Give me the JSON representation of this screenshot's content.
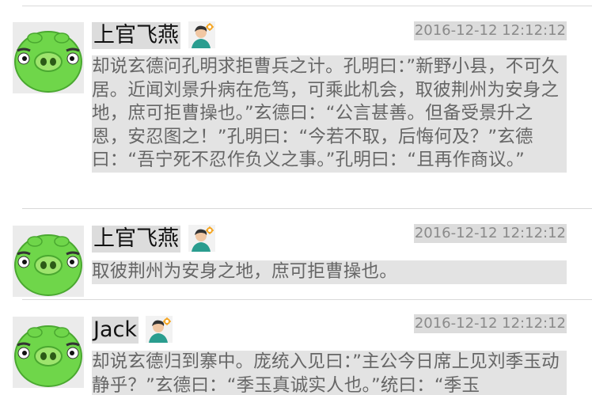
{
  "posts": [
    {
      "username": "上官飞燕",
      "timestamp": "2016-12-12 12:12:12",
      "content": "却说玄德问孔明求拒曹兵之计。孔明曰：”新野小县，不可久居。近闻刘景升病在危笃，可乘此机会，取彼荆州为安身之地，庶可拒曹操也。”玄德曰：“公言甚善。但备受景升之恩，安忍图之！”孔明曰：“今若不取，后悔何及？”玄德曰：“吾宁死不忍作负义之事。”孔明曰：“且再作商议。”",
      "avatar_icon": "green-pig-avatar-icon",
      "badge_icon": "user-badge-icon"
    },
    {
      "username": "上官飞燕",
      "timestamp": "2016-12-12 12:12:12",
      "content": "取彼荆州为安身之地，庶可拒曹操也。",
      "avatar_icon": "green-pig-avatar-icon",
      "badge_icon": "user-badge-icon"
    },
    {
      "username": "Jack",
      "timestamp": "2016-12-12 12:12:12",
      "content": "却说玄德归到寨中。庞统入见曰：”主公今日席上见刘季玉动静乎？”玄德曰：“季玉真诚实人也。”统曰：“季玉",
      "avatar_icon": "green-pig-avatar-icon",
      "badge_icon": "user-badge-icon"
    }
  ],
  "colors": {
    "pig_green": "#6fd64a",
    "badge_teal": "#2a9d8f",
    "text_gray": "#666666",
    "highlight_gray": "#e3e3e3"
  }
}
